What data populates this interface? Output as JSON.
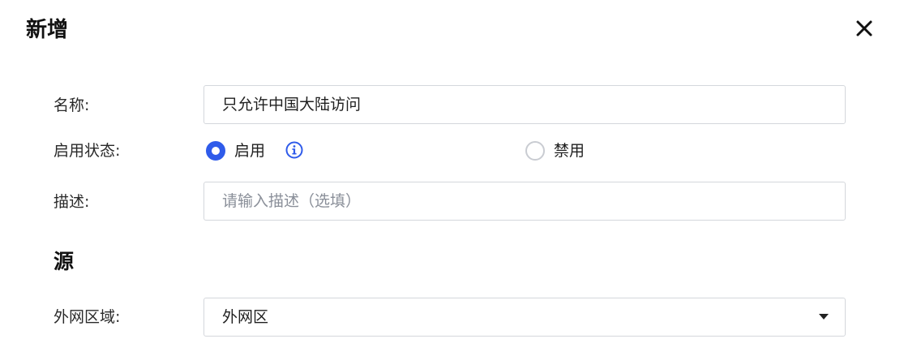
{
  "dialog": {
    "title": "新增"
  },
  "form": {
    "name": {
      "label": "名称:",
      "value": "只允许中国大陆访问"
    },
    "status": {
      "label": "启用状态:",
      "options": [
        {
          "label": "启用",
          "checked": true
        },
        {
          "label": "禁用",
          "checked": false
        }
      ]
    },
    "description": {
      "label": "描述:",
      "placeholder": "请输入描述（选填）",
      "value": ""
    }
  },
  "source": {
    "title": "源",
    "region": {
      "label": "外网区域:",
      "value": "外网区"
    }
  },
  "colors": {
    "accent": "#2f5bea",
    "border": "#d4d7dc",
    "placeholder": "#8a8f99"
  },
  "icons": [
    "close-icon",
    "info-icon",
    "caret-down-icon"
  ]
}
